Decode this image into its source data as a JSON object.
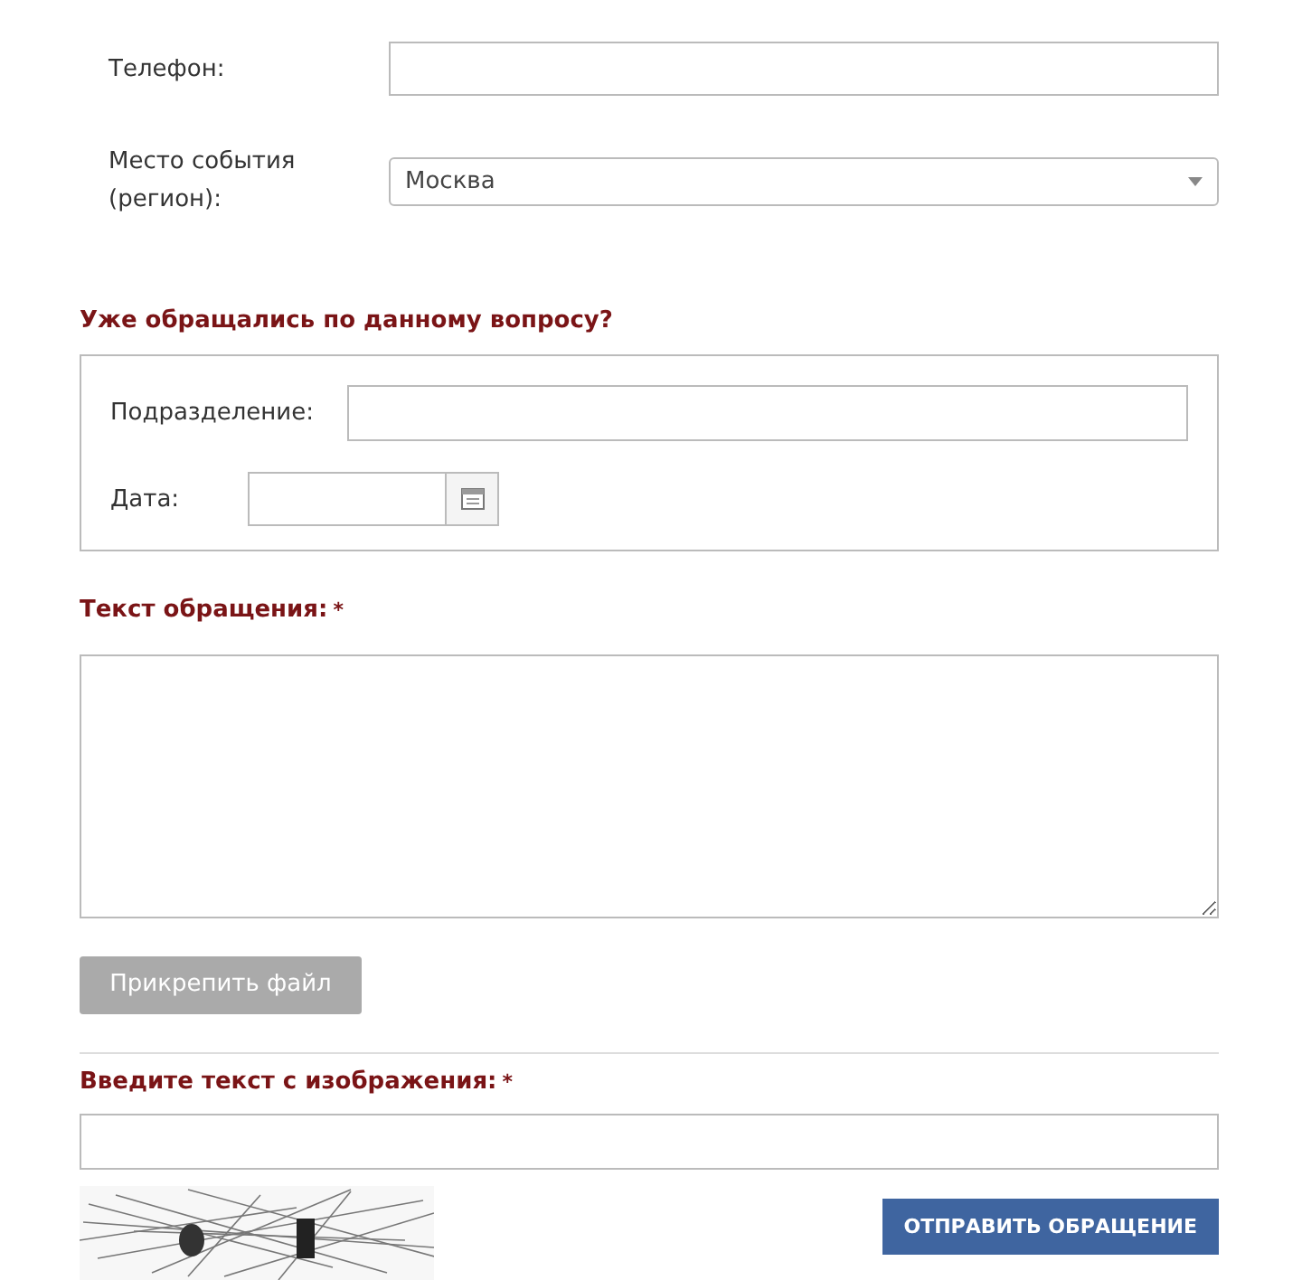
{
  "contact_fields": [
    {
      "kind": "text",
      "label": "Телефон:"
    },
    {
      "kind": "select",
      "label": "Место события (регион):",
      "value": "Москва"
    }
  ],
  "previous_request": {
    "heading": "Уже обращались по данному вопросу?",
    "department_label": "Подразделение:",
    "date_label": "Дата:"
  },
  "message": {
    "label": "Текст обращения:",
    "required_mark": "*"
  },
  "attach_button": {
    "label": "Прикрепить файл",
    "disabled": true
  },
  "captcha": {
    "label": "Введите текст с изображения:",
    "required_mark": "*"
  },
  "submit_button": {
    "label": "ОТПРАВИТЬ ОБРАЩЕНИЕ"
  }
}
